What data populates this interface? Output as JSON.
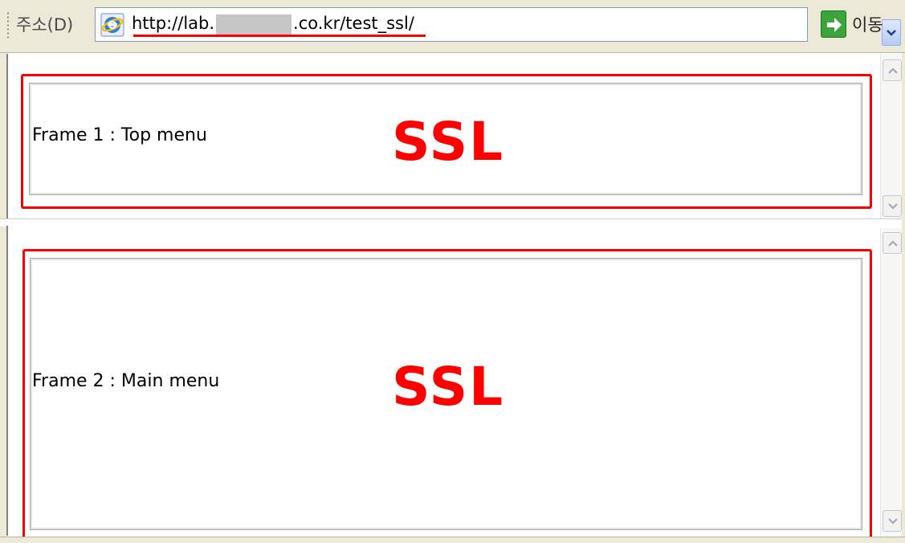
{
  "address_bar": {
    "label": "주소(D)",
    "url_prefix": "http://lab.",
    "url_suffix": ".co.kr/test_ssl/",
    "go_label": "이동"
  },
  "frames": [
    {
      "label": "Frame 1 : Top menu",
      "badge": "SSL"
    },
    {
      "label": "Frame 2 : Main menu",
      "badge": "SSL"
    }
  ],
  "colors": {
    "highlight": "#ff0000",
    "chrome": "#ece9d8"
  }
}
